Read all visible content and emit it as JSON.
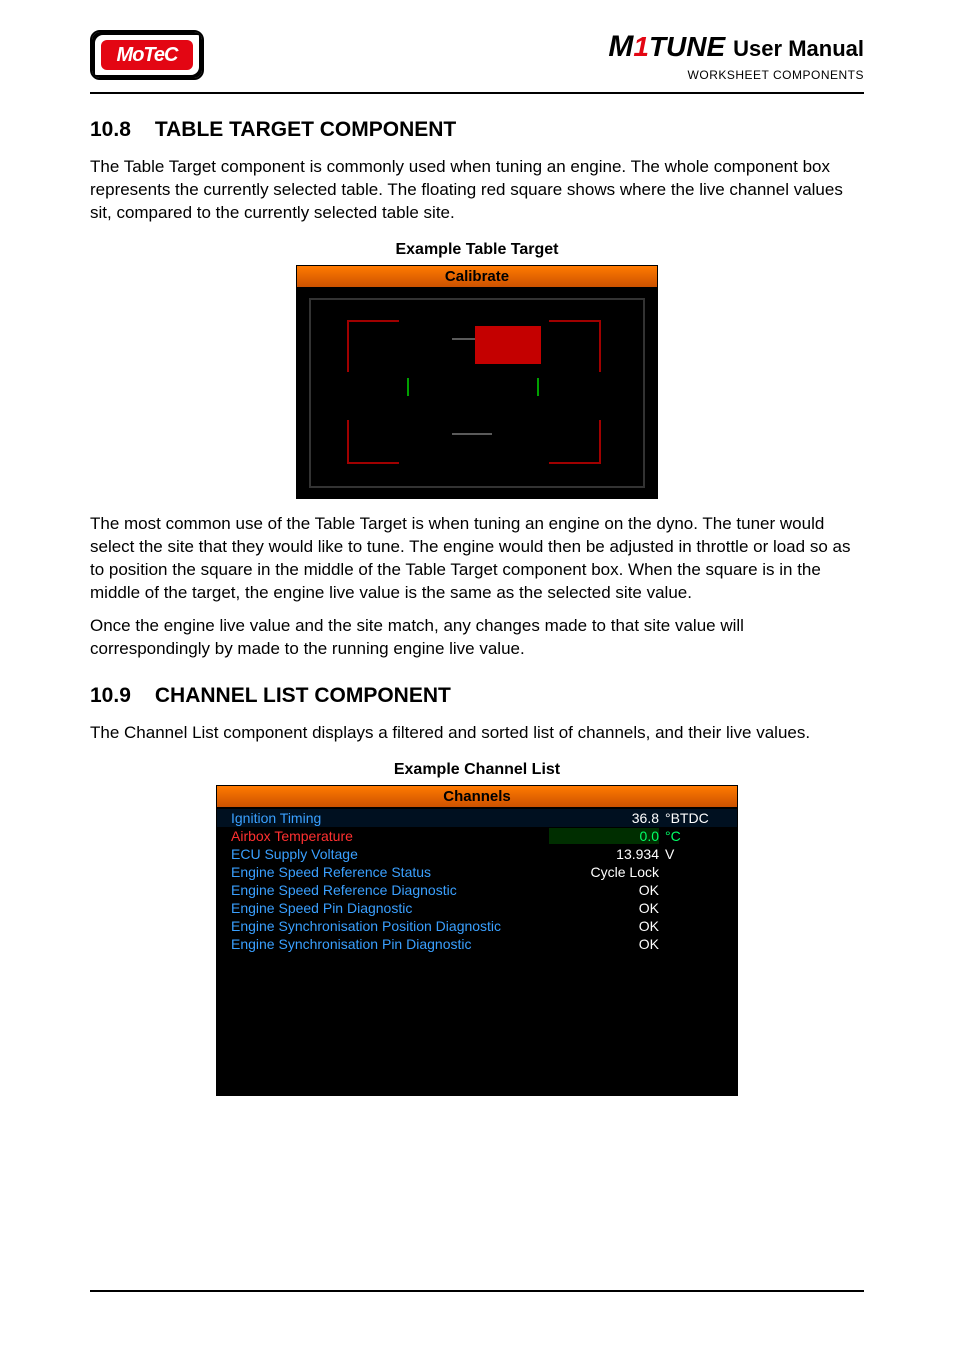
{
  "header": {
    "logo_text": "MoTeC",
    "product_mark_m": "M",
    "product_mark_tune": "TUNE",
    "product_mark_red": "1",
    "manual_label": "User Manual",
    "section_label": "WORKSHEET COMPONENTS"
  },
  "section1": {
    "number": "10.8",
    "title": "TABLE TARGET COMPONENT",
    "para1": "The Table Target component is commonly used when tuning an engine. The whole component box represents the currently selected table. The floating red square shows where the live channel values sit, compared to the currently selected table site.",
    "figure_caption": "Example Table Target",
    "figure_header": "Calibrate",
    "para2": "The most common use of the Table Target is when tuning an engine on the dyno. The tuner would select the site that they would like to tune. The engine would then be adjusted in throttle or load so as to position the square in the middle of the Table Target component box. When the square is in the middle of the target, the engine live value is the same as the selected site value.",
    "para3": "Once the engine live value and the site match, any changes made to that site value will correspondingly by made to the running engine live value."
  },
  "section2": {
    "number": "10.9",
    "title": "CHANNEL LIST COMPONENT",
    "para1": "The Channel List component displays a filtered and sorted list of channels, and their live values.",
    "figure_caption": "Example Channel List",
    "figure_header": "Channels",
    "rows": [
      {
        "name": "Ignition Timing",
        "value": "36.8",
        "unit": "°BTDC",
        "highlight": false,
        "selected": true
      },
      {
        "name": "Airbox Temperature",
        "value": "0.0",
        "unit": "°C",
        "highlight": true,
        "selected": false
      },
      {
        "name": "ECU Supply Voltage",
        "value": "13.934",
        "unit": "V",
        "highlight": false,
        "selected": false
      },
      {
        "name": "Engine Speed Reference Status",
        "value": "Cycle Lock",
        "unit": "",
        "highlight": false,
        "selected": false
      },
      {
        "name": "Engine Speed Reference Diagnostic",
        "value": "OK",
        "unit": "",
        "highlight": false,
        "selected": false
      },
      {
        "name": "Engine Speed Pin Diagnostic",
        "value": "OK",
        "unit": "",
        "highlight": false,
        "selected": false
      },
      {
        "name": "Engine Synchronisation Position Diagnostic",
        "value": "OK",
        "unit": "",
        "highlight": false,
        "selected": false
      },
      {
        "name": "Engine Synchronisation Pin Diagnostic",
        "value": "OK",
        "unit": "",
        "highlight": false,
        "selected": false
      }
    ]
  }
}
